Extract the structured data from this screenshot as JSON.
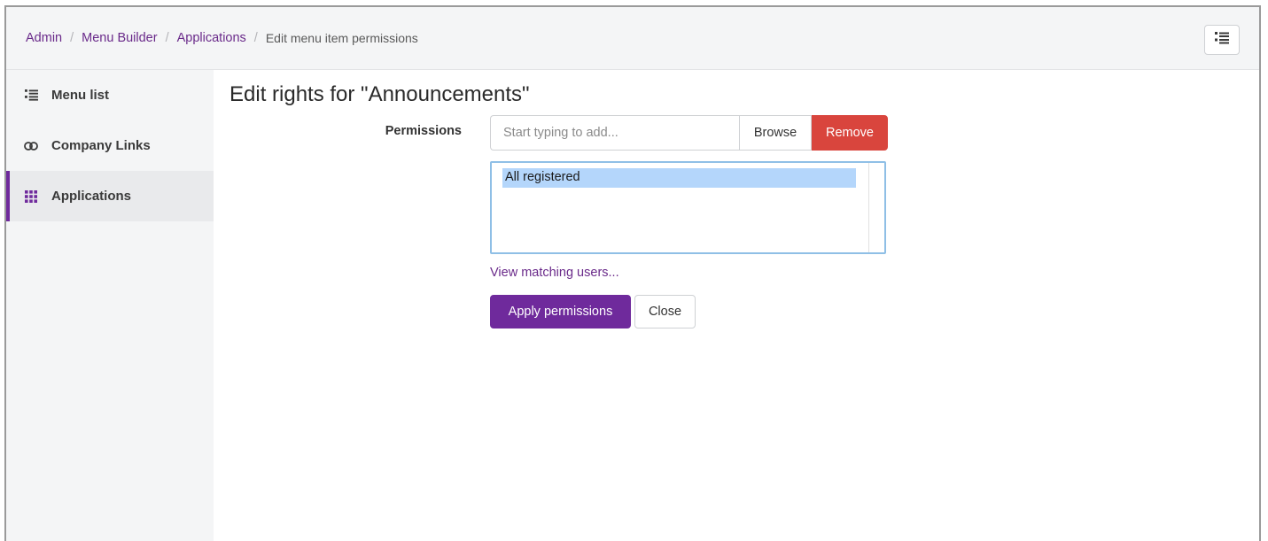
{
  "breadcrumb": {
    "items": [
      "Admin",
      "Menu Builder",
      "Applications"
    ],
    "current": "Edit menu item permissions",
    "separator": "/"
  },
  "header": {
    "toggle_icon": "list-icon"
  },
  "sidebar": {
    "items": [
      {
        "label": "Menu list",
        "icon": "list-icon",
        "active": false
      },
      {
        "label": "Company Links",
        "icon": "link-icon",
        "active": false
      },
      {
        "label": "Applications",
        "icon": "grid-icon",
        "active": true
      }
    ]
  },
  "main": {
    "title": "Edit rights for \"Announcements\"",
    "permissions_label": "Permissions",
    "input_placeholder": "Start typing to add...",
    "browse_label": "Browse",
    "remove_label": "Remove",
    "selected_permissions": [
      "All registered"
    ],
    "view_link": "View matching users...",
    "apply_label": "Apply permissions",
    "close_label": "Close"
  },
  "colors": {
    "accent": "#6f2a9c",
    "link": "#6a2a8a",
    "danger": "#d9453d",
    "selection": "#b4d6fb"
  }
}
